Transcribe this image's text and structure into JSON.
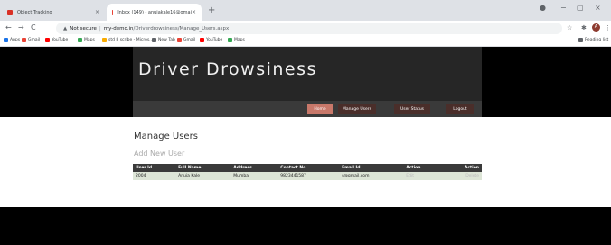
{
  "browser": {
    "tabs": [
      {
        "title": "Object Tracking"
      },
      {
        "title": "Inbox (149) - anujakale16@gmai"
      }
    ],
    "new_tab": "+",
    "tab_close": "×",
    "window_controls": {
      "minimize": "−",
      "restore": "▢",
      "close": "×"
    },
    "nav": {
      "back": "←",
      "forward": "→",
      "reload": "C"
    },
    "address": {
      "security": "Not secure",
      "host": "my-demo.in",
      "path": "/Driverdrowsiness/Manage_Users.aspx"
    },
    "bookmarks": [
      {
        "label": "Apps",
        "color": "#1a73e8"
      },
      {
        "label": "Gmail",
        "color": "#ea4335"
      },
      {
        "label": "YouTube",
        "color": "#ff0000"
      },
      {
        "label": "Maps",
        "color": "#34a853"
      },
      {
        "label": "std 8 scribe - Micros...",
        "color": "#f9ab00"
      },
      {
        "label": "New Tab",
        "color": "#5f6368"
      },
      {
        "label": "Gmail",
        "color": "#ea4335"
      },
      {
        "label": "YouTube",
        "color": "#ff0000"
      },
      {
        "label": "Maps",
        "color": "#34a853"
      }
    ],
    "reading_list": "Reading list",
    "profile_initial": "A"
  },
  "site": {
    "title": "Driver Drowsiness",
    "menu": [
      {
        "label": "Home",
        "active": true
      },
      {
        "label": "Manage Users",
        "active": false
      },
      {
        "label": "User Status",
        "active": false
      },
      {
        "label": "Logout",
        "active": false
      }
    ]
  },
  "main": {
    "heading": "Manage Users",
    "add_link": "Add New User",
    "table": {
      "columns": [
        "User Id",
        "Full Name",
        "Address",
        "Contact No",
        "Email Id",
        "Action",
        "Action"
      ],
      "rows": [
        {
          "user_id": "2004",
          "full_name": "Anuja Kale",
          "address": "Mumbai",
          "contact": "9823441587",
          "email": "s@gmail.com",
          "edit": "Edit",
          "delete": "Delete"
        }
      ]
    }
  },
  "colors": {
    "header_bg": "#262626",
    "menu_active": "#c8786a",
    "menu_button": "#4a2e2a",
    "table_header": "#3a3a3a",
    "table_row": "#dde5d7"
  }
}
